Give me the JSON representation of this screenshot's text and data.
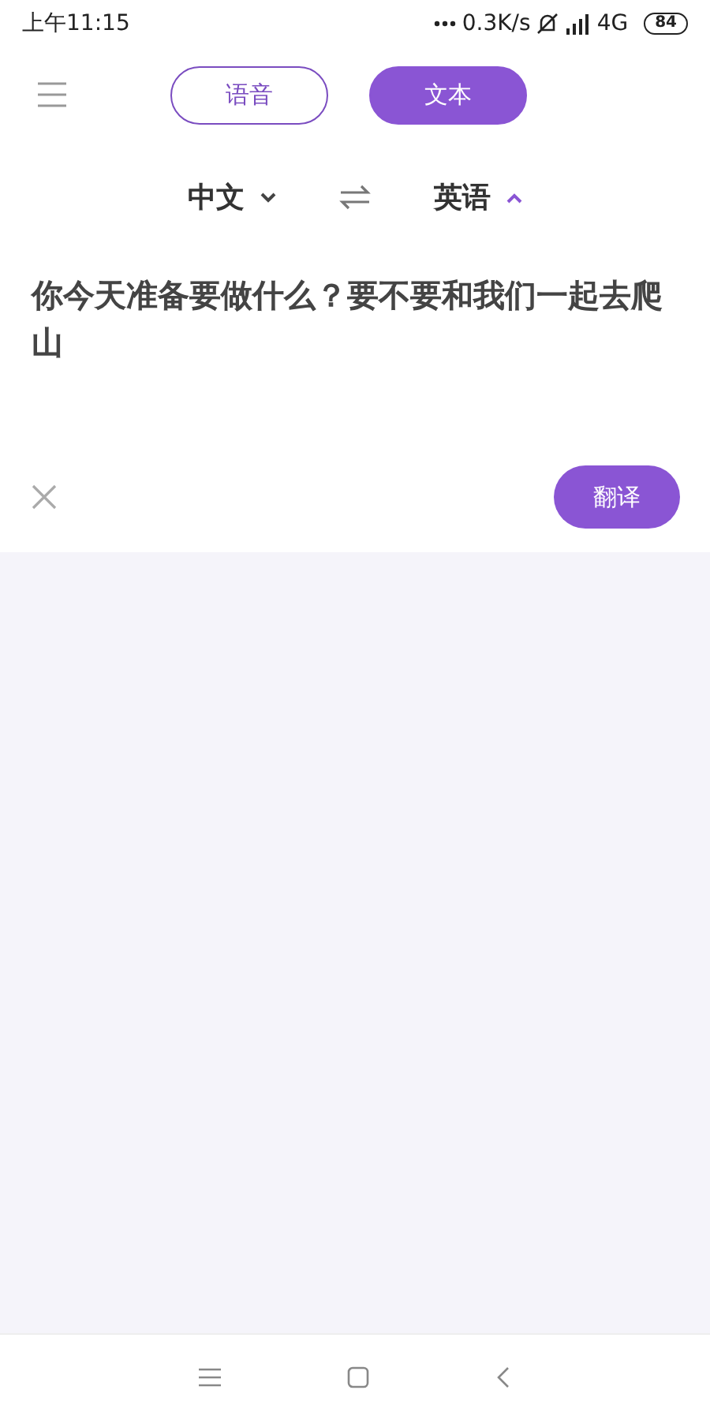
{
  "status_bar": {
    "time": "上午11:15",
    "speed": "0.3K/s",
    "network": "4G",
    "battery": "84"
  },
  "tabs": [
    {
      "label": "语音",
      "selected": false
    },
    {
      "label": "文本",
      "selected": true
    }
  ],
  "languages": [
    {
      "label": "中文",
      "expanded": false
    },
    {
      "label": "英语",
      "expanded": true
    }
  ],
  "input": {
    "value": "你今天准备要做什么？要不要和我们一起去爬山"
  },
  "translate_button": "翻译"
}
